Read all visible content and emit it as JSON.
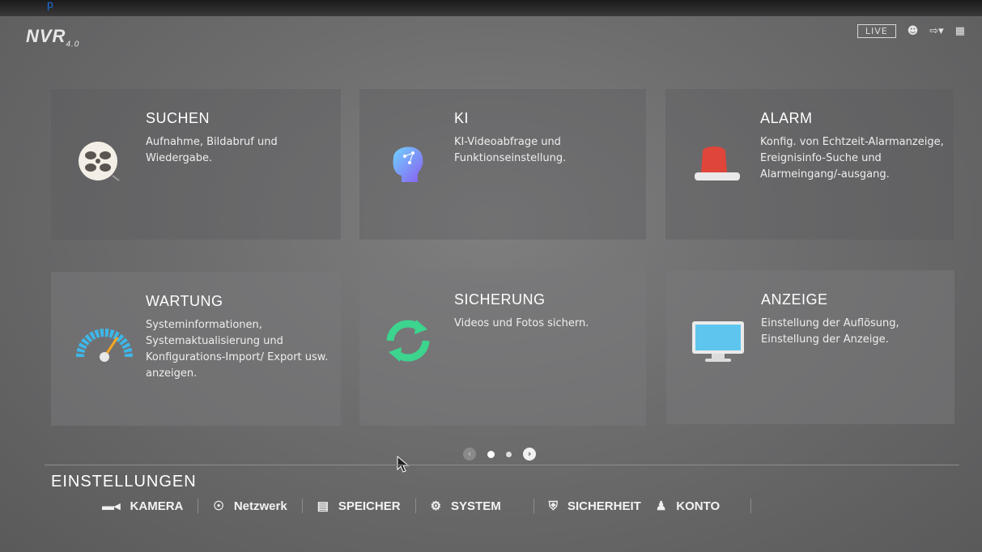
{
  "app": {
    "logo": "NVR",
    "logo_version": "4.0"
  },
  "topbar": {
    "live_label": "LIVE",
    "user_icon": "user-icon",
    "logout_icon": "logout-icon",
    "grid_icon": "qr-icon"
  },
  "tiles": [
    {
      "title": "SUCHEN",
      "desc": "Aufnahme, Bildabruf und Wiedergabe.",
      "icon": "film-reel-icon"
    },
    {
      "title": "KI",
      "desc": "KI-Videoabfrage und Funktionseinstellung.",
      "icon": "ai-head-icon"
    },
    {
      "title": "ALARM",
      "desc": "Konfig. von Echtzeit-Alarmanzeige, Ereignisinfo-Suche und Alarmeingang/-ausgang.",
      "icon": "alarm-light-icon"
    },
    {
      "title": "WARTUNG",
      "desc": "Systeminformationen, Systemaktualisierung und Konfigurations-Import/ Export usw. anzeigen.",
      "icon": "gauge-icon"
    },
    {
      "title": "SICHERUNG",
      "desc": "Videos und Fotos sichern.",
      "icon": "sync-icon"
    },
    {
      "title": "ANZEIGE",
      "desc": "Einstellung der Auflösung, Einstellung der Anzeige.",
      "icon": "monitor-icon"
    }
  ],
  "pager": {
    "pages": 3,
    "current": 1
  },
  "settings": {
    "title": "EINSTELLUNGEN",
    "items": [
      {
        "label": "KAMERA",
        "icon": "camera-icon"
      },
      {
        "label": "Netzwerk",
        "icon": "globe-icon"
      },
      {
        "label": "SPEICHER",
        "icon": "storage-icon"
      },
      {
        "label": "SYSTEM",
        "icon": "gears-icon"
      },
      {
        "label": "SICHERHEIT",
        "icon": "shield-icon"
      },
      {
        "label": "KONTO",
        "icon": "users-gear-icon"
      }
    ]
  },
  "colors": {
    "screen_bg": "#747475",
    "tile_bg": "#8a8a8c",
    "alarm_red": "#e0453a",
    "sync_green": "#3cd48e",
    "gauge_blue": "#3fb6e8",
    "monitor_blue": "#5ec6ee"
  }
}
